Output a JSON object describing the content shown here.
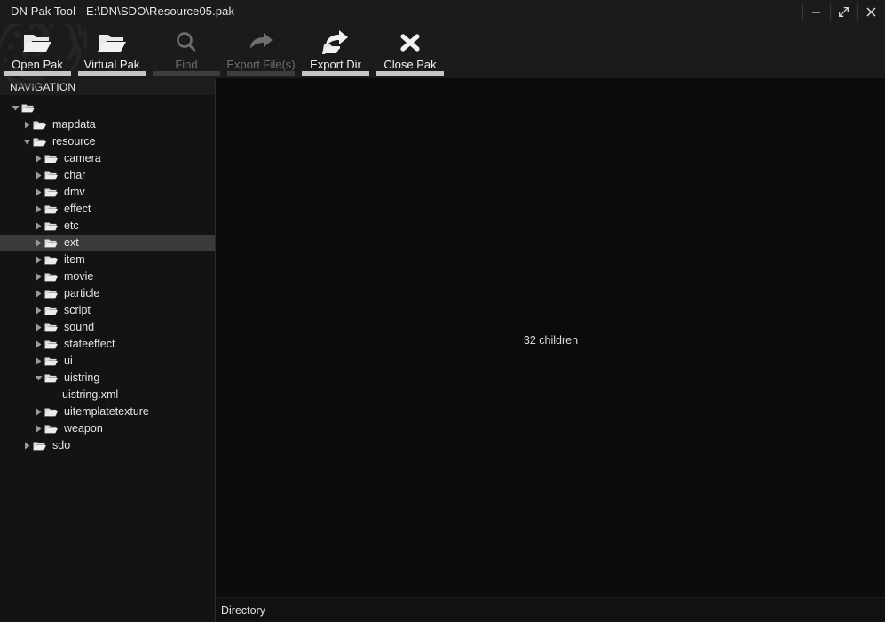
{
  "window": {
    "title": "DN Pak Tool - E:\\DN\\SDO\\Resource05.pak",
    "controls": {
      "minimize": "minimize-icon",
      "maximize": "maximize-icon",
      "close": "close-icon"
    }
  },
  "toolbar": {
    "buttons": [
      {
        "label": "Open Pak",
        "icon": "open-folder-icon",
        "enabled": true
      },
      {
        "label": "Virtual Pak",
        "icon": "open-folder-icon",
        "enabled": true
      },
      {
        "label": "Find",
        "icon": "search-icon",
        "enabled": false
      },
      {
        "label": "Export File(s)",
        "icon": "export-arrow-icon",
        "enabled": false
      },
      {
        "label": "Export Dir",
        "icon": "export-folder-arrow-icon",
        "enabled": true
      },
      {
        "label": "Close Pak",
        "icon": "close-x-icon",
        "enabled": true
      }
    ]
  },
  "sidebar": {
    "header": "NAVIGATION",
    "tree": [
      {
        "label": "",
        "depth": 0,
        "type": "folder",
        "state": "expanded",
        "selected": false
      },
      {
        "label": "mapdata",
        "depth": 1,
        "type": "folder",
        "state": "collapsed",
        "selected": false
      },
      {
        "label": "resource",
        "depth": 1,
        "type": "folder",
        "state": "expanded",
        "selected": false
      },
      {
        "label": "camera",
        "depth": 2,
        "type": "folder",
        "state": "collapsed",
        "selected": false
      },
      {
        "label": "char",
        "depth": 2,
        "type": "folder",
        "state": "collapsed",
        "selected": false
      },
      {
        "label": "dmv",
        "depth": 2,
        "type": "folder",
        "state": "collapsed",
        "selected": false
      },
      {
        "label": "effect",
        "depth": 2,
        "type": "folder",
        "state": "collapsed",
        "selected": false
      },
      {
        "label": "etc",
        "depth": 2,
        "type": "folder",
        "state": "collapsed",
        "selected": false
      },
      {
        "label": "ext",
        "depth": 2,
        "type": "folder",
        "state": "collapsed",
        "selected": true
      },
      {
        "label": "item",
        "depth": 2,
        "type": "folder",
        "state": "collapsed",
        "selected": false
      },
      {
        "label": "movie",
        "depth": 2,
        "type": "folder",
        "state": "collapsed",
        "selected": false
      },
      {
        "label": "particle",
        "depth": 2,
        "type": "folder",
        "state": "collapsed",
        "selected": false
      },
      {
        "label": "script",
        "depth": 2,
        "type": "folder",
        "state": "collapsed",
        "selected": false
      },
      {
        "label": "sound",
        "depth": 2,
        "type": "folder",
        "state": "collapsed",
        "selected": false
      },
      {
        "label": "stateeffect",
        "depth": 2,
        "type": "folder",
        "state": "collapsed",
        "selected": false
      },
      {
        "label": "ui",
        "depth": 2,
        "type": "folder",
        "state": "collapsed",
        "selected": false
      },
      {
        "label": "uistring",
        "depth": 2,
        "type": "folder",
        "state": "expanded",
        "selected": false
      },
      {
        "label": "uistring.xml",
        "depth": 3,
        "type": "file",
        "state": "none",
        "selected": false
      },
      {
        "label": "uitemplatetexture",
        "depth": 2,
        "type": "folder",
        "state": "collapsed",
        "selected": false
      },
      {
        "label": "weapon",
        "depth": 2,
        "type": "folder",
        "state": "collapsed",
        "selected": false
      },
      {
        "label": "sdo",
        "depth": 1,
        "type": "folder",
        "state": "collapsed",
        "selected": false
      }
    ]
  },
  "main": {
    "children_count": "32 children"
  },
  "statusbar": {
    "text": "Directory"
  },
  "colors": {
    "titlebar_bg": "#1b1b1b",
    "toolbar_bg": "#1b1b1b",
    "sidebar_bg": "#131313",
    "main_bg": "#0b0b0b",
    "selection_bg": "#3b3b3b",
    "text": "#e6e6e6",
    "text_disabled": "#6e6e6e",
    "accent_underline": "#c6c6c6"
  }
}
